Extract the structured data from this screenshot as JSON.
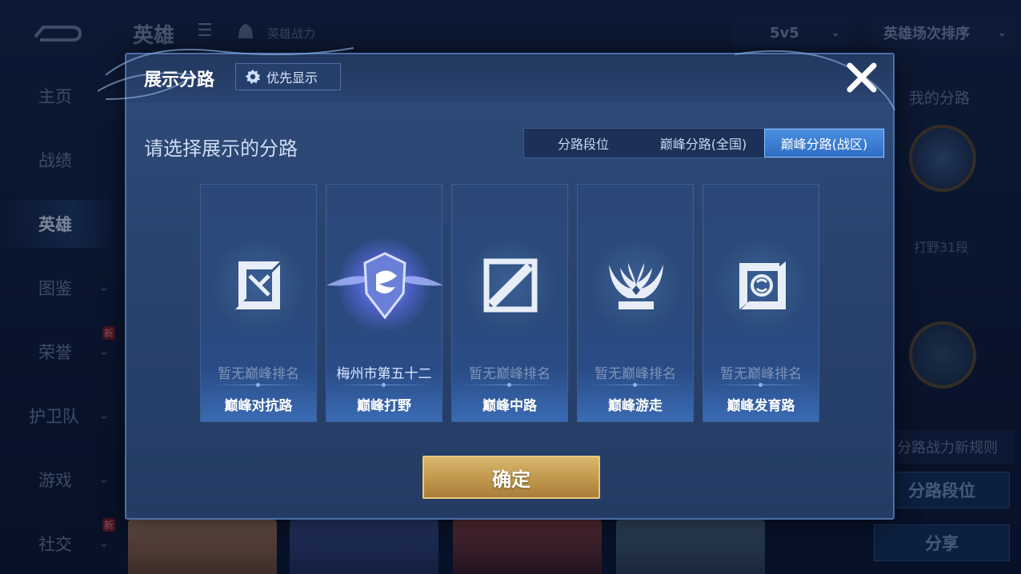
{
  "background": {
    "header": {
      "title": "英雄",
      "power_label": "英雄战力",
      "mode_select": "5v5",
      "sort_select": "英雄场次排序"
    },
    "sidebar": [
      {
        "label": "主页",
        "chevron": false,
        "new": false,
        "active": false
      },
      {
        "label": "战绩",
        "chevron": false,
        "new": false,
        "active": false
      },
      {
        "label": "英雄",
        "chevron": false,
        "new": false,
        "active": true
      },
      {
        "label": "图鉴",
        "chevron": true,
        "new": false,
        "active": false
      },
      {
        "label": "荣誉",
        "chevron": true,
        "new": true,
        "active": false
      },
      {
        "label": "护卫队",
        "chevron": true,
        "new": false,
        "active": false
      },
      {
        "label": "游戏",
        "chevron": true,
        "new": false,
        "active": false
      },
      {
        "label": "社交",
        "chevron": true,
        "new": true,
        "active": false
      }
    ],
    "new_badge": "新",
    "right_panel": {
      "title": "我的分路",
      "rank": "打野31段",
      "rule_text": "分路战力新规则",
      "lane_rank_button": "分路段位",
      "share_button": "分享"
    }
  },
  "dialog": {
    "title": "展示分路",
    "priority_button": "优先显示",
    "subtitle": "请选择展示的分路",
    "tabs": [
      "分路段位",
      "巅峰分路(全国)",
      "巅峰分路(战区)"
    ],
    "selected_tab": "巅峰分路(战区)",
    "cards": [
      {
        "rank": "暂无巅峰排名",
        "name": "巅峰对抗路",
        "icon": "clash-lane-icon",
        "has_rank": false
      },
      {
        "rank": "梅州市第五十二",
        "name": "巅峰打野",
        "icon": "jungle-emblem-icon",
        "has_rank": true
      },
      {
        "rank": "暂无巅峰排名",
        "name": "巅峰中路",
        "icon": "mid-lane-icon",
        "has_rank": false
      },
      {
        "rank": "暂无巅峰排名",
        "name": "巅峰游走",
        "icon": "roam-icon",
        "has_rank": false
      },
      {
        "rank": "暂无巅峰排名",
        "name": "巅峰发育路",
        "icon": "farm-lane-icon",
        "has_rank": false
      }
    ],
    "confirm_button": "确定"
  },
  "colors": {
    "dialog_bg": "#2a4470",
    "tab_selected": "#3a7ed6",
    "confirm_gold": "#c8a25a",
    "page_bg": "#0c1730"
  }
}
